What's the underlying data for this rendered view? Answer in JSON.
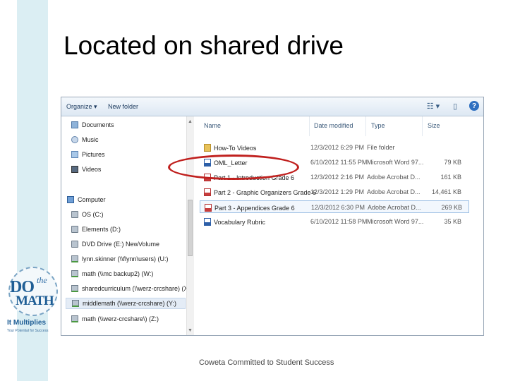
{
  "slide": {
    "title": "Located on shared drive",
    "footer": "Coweta Committed to Student Success"
  },
  "logo": {
    "do": "DO",
    "the": "the",
    "math": "MATH",
    "tagline_bold": "It Multiplies",
    "tagline_small": "Your Potential for Success"
  },
  "toolbar": {
    "organize_label": "Organize ▾",
    "new_folder_label": "New folder",
    "help_label": "?"
  },
  "nav": {
    "items": [
      {
        "label": "Documents",
        "icon": "documents-icon"
      },
      {
        "label": "Music",
        "icon": "music-icon"
      },
      {
        "label": "Pictures",
        "icon": "pictures-icon"
      },
      {
        "label": "Videos",
        "icon": "videos-icon"
      },
      {
        "label": "Computer",
        "icon": "computer-icon"
      },
      {
        "label": "OS (C:)",
        "icon": "drive-icon"
      },
      {
        "label": "Elements (D:)",
        "icon": "drive-icon"
      },
      {
        "label": "DVD Drive (E:) NewVolume",
        "icon": "dvd-icon"
      },
      {
        "label": "lynn.skinner (\\\\flynn\\users) (U:)",
        "icon": "network-drive-icon"
      },
      {
        "label": "math (\\\\mc backup2) (W:)",
        "icon": "network-drive-icon"
      },
      {
        "label": "sharedcurriculum (\\\\werz-crcshare) (X:)",
        "icon": "network-drive-icon"
      },
      {
        "label": "middlemath (\\\\werz-crcshare) (Y:)",
        "icon": "network-drive-icon"
      },
      {
        "label": "math (\\\\werz-crcshare\\) (Z:)",
        "icon": "network-drive-icon"
      }
    ]
  },
  "files": {
    "columns": {
      "name": "Name",
      "date": "Date modified",
      "type": "Type",
      "size": "Size"
    },
    "rows": [
      {
        "name": "How-To Videos",
        "date": "12/3/2012 6:29 PM",
        "type": "File folder",
        "size": "",
        "icon": "folder-icon"
      },
      {
        "name": "OML_Letter",
        "date": "6/10/2012 11:55 PM",
        "type": "Microsoft Word 97...",
        "size": "79 KB",
        "icon": "word-icon"
      },
      {
        "name": "Part 1 - Introduction Grade 6",
        "date": "12/3/2012 2:16 PM",
        "type": "Adobe Acrobat D...",
        "size": "161 KB",
        "icon": "pdf-icon"
      },
      {
        "name": "Part 2 - Graphic Organizers Grade 6",
        "date": "12/3/2012 1:29 PM",
        "type": "Adobe Acrobat D...",
        "size": "14,461 KB",
        "icon": "pdf-icon"
      },
      {
        "name": "Part 3 - Appendices Grade 6",
        "date": "12/3/2012 6:30 PM",
        "type": "Adobe Acrobat D...",
        "size": "269 KB",
        "icon": "pdf-icon"
      },
      {
        "name": "Vocabulary Rubric",
        "date": "6/10/2012 11:58 PM",
        "type": "Microsoft Word 97...",
        "size": "35 KB",
        "icon": "word-icon"
      }
    ]
  },
  "colors": {
    "stripe": "#dbeef3",
    "highlight": "#c0201e",
    "selection": "#9dbfe4"
  }
}
